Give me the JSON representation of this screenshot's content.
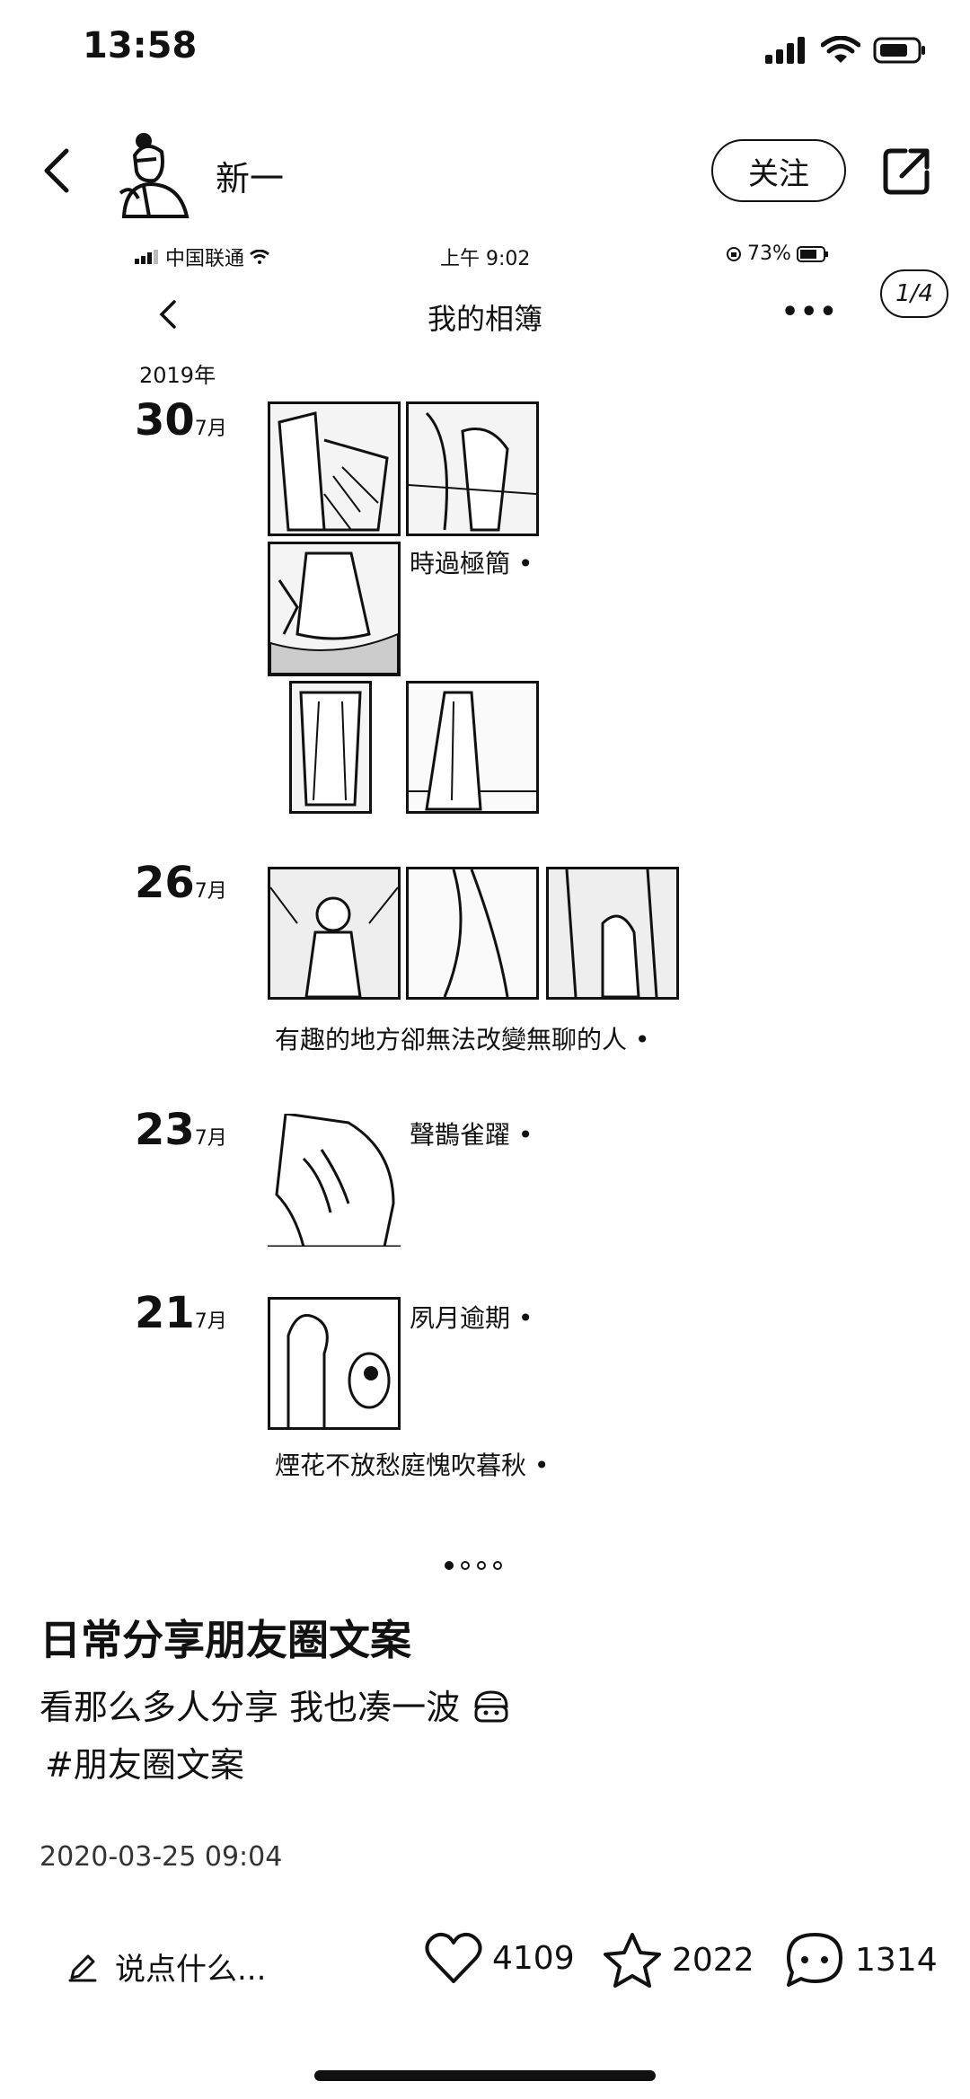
{
  "status_bar": {
    "time": "13:58"
  },
  "header": {
    "username": "新一",
    "follow_label": "关注"
  },
  "inner_screen": {
    "carrier": "中国联通",
    "clock": "上午 9:02",
    "battery": "73%",
    "title": "我的相簿",
    "more": "•••",
    "counter": "1/4",
    "year": "2019年",
    "entries": [
      {
        "day": "30",
        "month": "7月",
        "caption": "時過極簡 •"
      },
      {
        "day": "26",
        "month": "7月",
        "caption": "有趣的地方卻無法改變無聊的人 •"
      },
      {
        "day": "23",
        "month": "7月",
        "caption": "聲鵲雀躍 •"
      },
      {
        "day": "21",
        "month": "7月",
        "caption": "夙月逾期 •",
        "caption2": "煙花不放愁庭愧吹暮秋 •"
      }
    ]
  },
  "pager": {
    "count": 4,
    "active": 0
  },
  "post": {
    "title": "日常分享朋友圈文案",
    "body": "看那么多人分享 我也凑一波",
    "tag": "#朋友圈文案",
    "date": "2020-03-25 09:04"
  },
  "bottom_bar": {
    "comment_placeholder": "说点什么...",
    "likes": "4109",
    "favorites": "2022",
    "comments": "1314"
  },
  "icons": {
    "back": "chevron-left-icon",
    "share": "share-icon",
    "like": "heart-icon",
    "favorite": "star-icon",
    "comment": "chat-bubble-icon",
    "edit": "pencil-icon"
  }
}
